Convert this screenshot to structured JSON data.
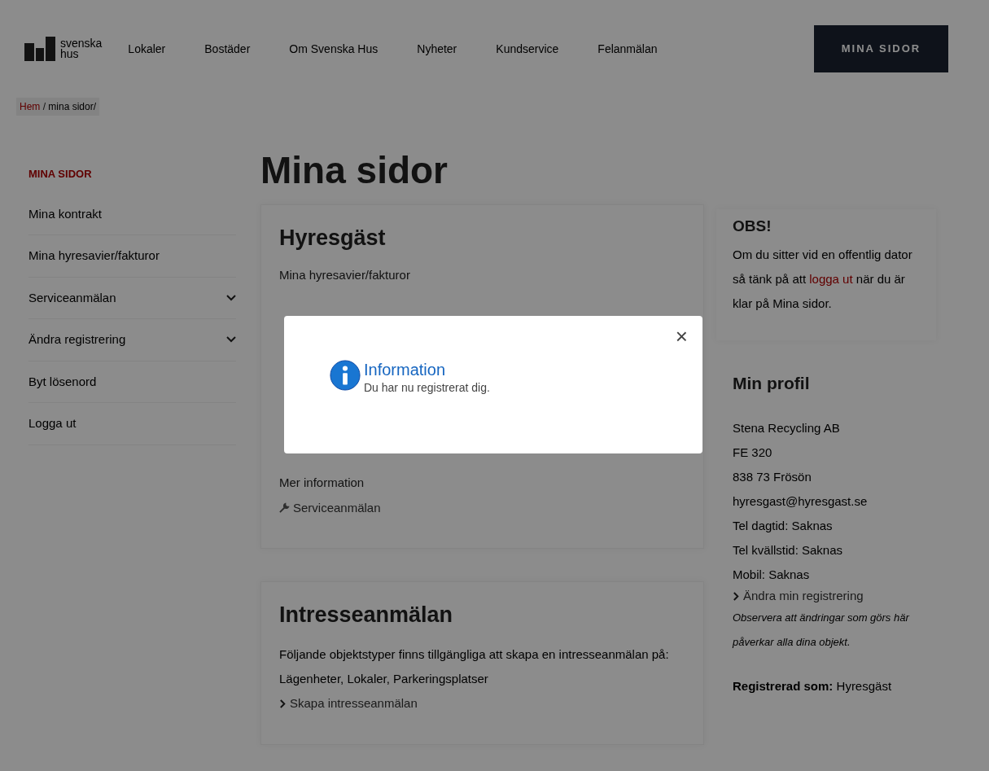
{
  "header": {
    "logo": [
      "svenska",
      "hus"
    ],
    "nav": [
      "Lokaler",
      "Bostäder",
      "Om Svenska Hus",
      "Nyheter",
      "Kundservice",
      "Felanmälan"
    ],
    "button": "MINA SIDOR"
  },
  "breadcrumb": {
    "separator": "/",
    "items": [
      "Hem",
      "mina sidor/"
    ]
  },
  "sidebar": {
    "title": "MINA SIDOR",
    "items": [
      {
        "label": "Mina kontrakt",
        "expandable": false
      },
      {
        "label": "Mina hyresavier/fakturor",
        "expandable": false
      },
      {
        "label": "Serviceanmälan",
        "expandable": true
      },
      {
        "label": "Ändra registrering",
        "expandable": true
      },
      {
        "label": "Byt lösenord",
        "expandable": false
      },
      {
        "label": "Logga ut",
        "expandable": false
      }
    ]
  },
  "main": {
    "title": "Mina sidor",
    "cards": [
      {
        "title": "Hyresgäst",
        "groups": [
          {
            "heading": "Mina hyresavier/fakturor"
          },
          {
            "heading": "Mer information",
            "links": [
              {
                "label": "Serviceanmälan",
                "kind": "wrench"
              }
            ]
          }
        ]
      },
      {
        "title": "Intresseanmälan",
        "text": "Följande objektstyper finns tillgängliga att skapa en intresseanmälan på: Lägenheter, Lokaler, Parkeringsplatser",
        "groups": [
          {
            "links": [
              {
                "label": "Skapa intresseanmälan",
                "kind": "chevron"
              }
            ]
          }
        ]
      }
    ]
  },
  "aside": {
    "obs": {
      "title": "OBS!",
      "before": "Om du sitter vid en offentlig dator så tänk på att",
      "link": "logga ut",
      "after": "när du är klar på Mina sidor."
    },
    "profile": {
      "title": "Min profil",
      "lines": [
        "Stena Recycling AB",
        "FE 320",
        "838 73 Frösön",
        "hyresgast@hyresgast.se",
        "Tel dagtid: Saknas",
        "Tel kvällstid: Saknas",
        "Mobil: Saknas"
      ],
      "link": "Ändra min registrering",
      "note": "Observera att ändringar som görs här påverkar alla dina objekt.",
      "registered_label": "Registrerad som:",
      "registered_value": "Hyresgäst"
    }
  },
  "modal": {
    "title": "Information",
    "message": "Du har nu registrerat dig.",
    "close": "×"
  }
}
